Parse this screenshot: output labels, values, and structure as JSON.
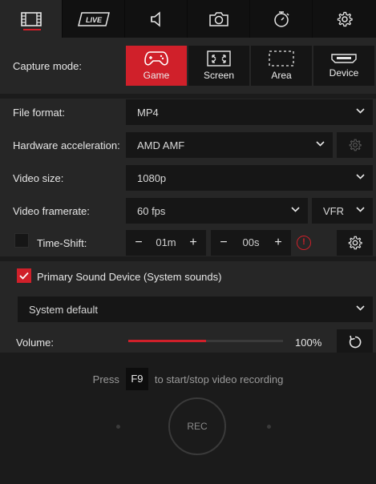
{
  "tabs": [
    {
      "name": "video-icon",
      "active": true
    },
    {
      "name": "live-icon",
      "label": "LIVE"
    },
    {
      "name": "speaker-icon"
    },
    {
      "name": "camera-icon"
    },
    {
      "name": "timer-icon"
    },
    {
      "name": "gear-icon"
    }
  ],
  "capture": {
    "label": "Capture mode:",
    "modes": [
      {
        "label": "Game",
        "icon": "gamepad-icon",
        "active": true
      },
      {
        "label": "Screen",
        "icon": "screen-icon"
      },
      {
        "label": "Area",
        "icon": "area-icon"
      },
      {
        "label": "Device",
        "icon": "device-icon"
      }
    ]
  },
  "settings": {
    "file_format": {
      "label": "File format:",
      "value": "MP4"
    },
    "hw_accel": {
      "label": "Hardware acceleration:",
      "value": "AMD AMF"
    },
    "video_size": {
      "label": "Video size:",
      "value": "1080p"
    },
    "framerate": {
      "label": "Video framerate:",
      "value": "60 fps",
      "mode": "VFR"
    },
    "timeshift": {
      "label": "Time-Shift:",
      "minutes": "01m",
      "seconds": "00s",
      "checked": false,
      "minus": "−",
      "plus": "+",
      "warning": "!"
    }
  },
  "sound": {
    "primary_label": "Primary Sound Device (System sounds)",
    "primary_checked": true,
    "device": "System default",
    "volume_label": "Volume:",
    "volume_value": "100%",
    "volume_fraction": 0.5
  },
  "record": {
    "hint_before": "Press",
    "hotkey": "F9",
    "hint_after": "to start/stop video recording",
    "button_label": "REC"
  },
  "colors": {
    "accent": "#d0202a",
    "panel": "#262626",
    "field": "#161616",
    "background": "#1b1b1b"
  }
}
